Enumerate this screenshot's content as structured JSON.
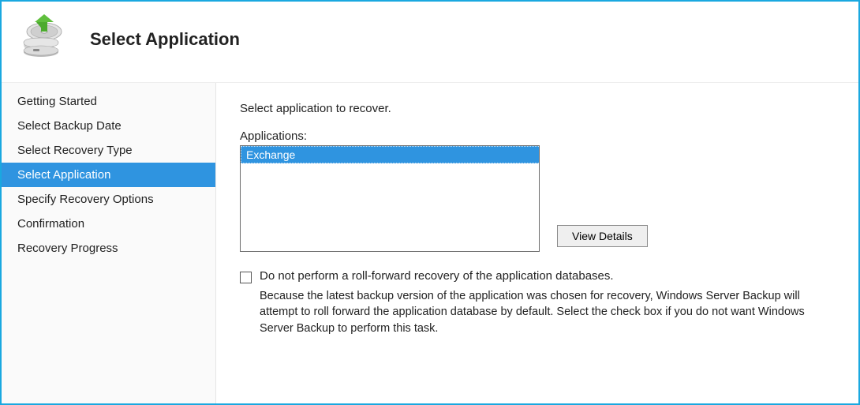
{
  "header": {
    "title": "Select Application"
  },
  "sidebar": {
    "items": [
      {
        "label": "Getting Started",
        "active": false
      },
      {
        "label": "Select Backup Date",
        "active": false
      },
      {
        "label": "Select Recovery Type",
        "active": false
      },
      {
        "label": "Select Application",
        "active": true
      },
      {
        "label": "Specify Recovery Options",
        "active": false
      },
      {
        "label": "Confirmation",
        "active": false
      },
      {
        "label": "Recovery Progress",
        "active": false
      }
    ]
  },
  "main": {
    "instruction": "Select application to recover.",
    "list_label": "Applications:",
    "applications": [
      "Exchange"
    ],
    "view_details_label": "View Details",
    "checkbox_label": "Do not perform a roll-forward recovery of the application databases.",
    "helper_text": "Because the latest backup version of the application was chosen for recovery, Windows Server Backup will attempt to roll forward the application database by default. Select the check box if you do not want Windows Server Backup to perform this task."
  }
}
